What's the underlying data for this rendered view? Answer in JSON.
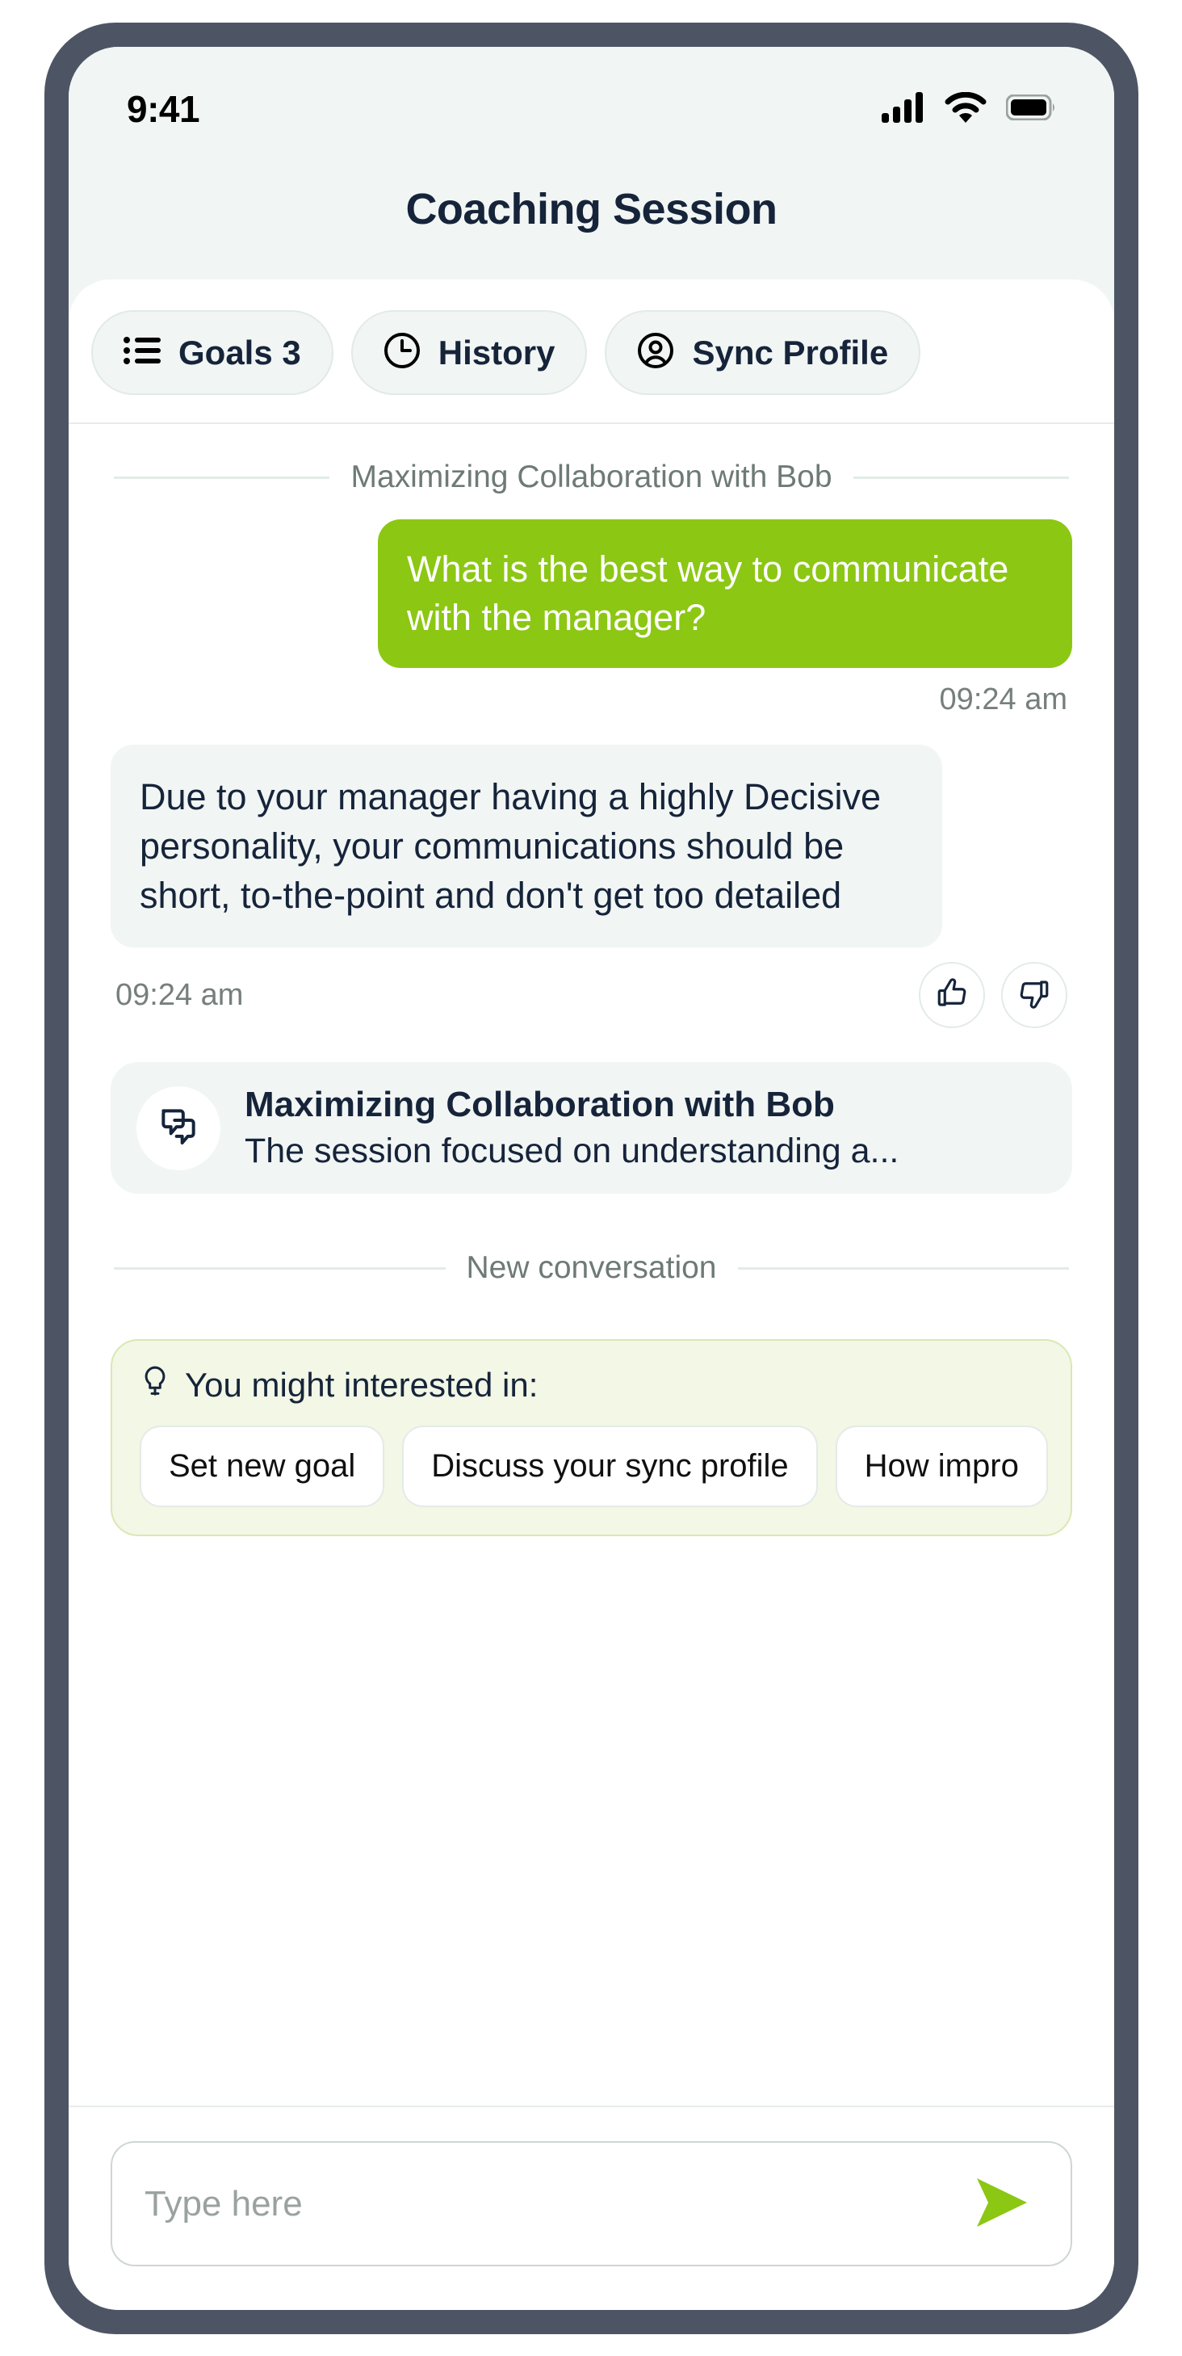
{
  "status_bar": {
    "time": "9:41",
    "icons": [
      "cellular-signal-icon",
      "wifi-icon",
      "battery-icon"
    ]
  },
  "header": {
    "title": "Coaching Session"
  },
  "pill_bar": {
    "pills": [
      {
        "label": "Goals 3",
        "icon": "list-icon"
      },
      {
        "label": "History",
        "icon": "clock-icon"
      },
      {
        "label": "Sync Profile",
        "icon": "user-circle-icon"
      }
    ]
  },
  "conversation": {
    "topic_divider_label": "Maximizing Collaboration with Bob",
    "user_message": {
      "text": "What is the best way to communicate with the manager?",
      "timestamp": "09:24 am"
    },
    "bot_message": {
      "text": "Due to your manager having a highly Decisive personality, your communications should be short, to-the-point and don't get too detailed",
      "timestamp": "09:24 am",
      "reactions": [
        {
          "name": "thumbs-up-icon"
        },
        {
          "name": "thumbs-down-icon"
        }
      ]
    },
    "summary_card": {
      "icon": "chat-bubbles-icon",
      "title": "Maximizing Collaboration with Bob",
      "snippet": "The session focused on understanding a..."
    },
    "new_conversation_divider_label": "New conversation"
  },
  "suggestions": {
    "icon": "lightbulb-icon",
    "title": "You might interested in:",
    "chips": [
      "Set new goal",
      "Discuss your sync profile",
      "How impro"
    ]
  },
  "composer": {
    "placeholder": "Type here",
    "value": "",
    "send_icon": "send-arrow-icon"
  },
  "colors": {
    "accent_green": "#8cc714",
    "suggestion_bg": "#f2f7e6",
    "bubble_gray": "#f1f5f4",
    "text_dark": "#16243a",
    "frame": "#4d5565"
  }
}
